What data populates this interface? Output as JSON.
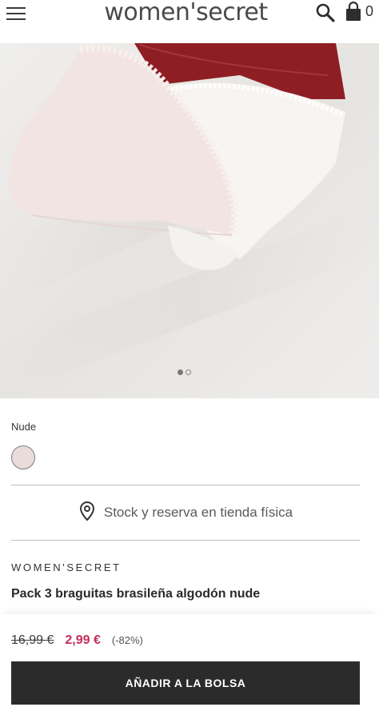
{
  "header": {
    "logo": "women'secret",
    "bag_count": "0"
  },
  "gallery": {
    "slide_count": 2,
    "active_slide": 1
  },
  "product": {
    "color_label": "Nude",
    "swatch_color": "#e9dcdb",
    "stock_label": "Stock y reserva en tienda física",
    "brand": "WOMEN'SECRET",
    "name": "Pack 3 braguitas brasileña algodón nude"
  },
  "price": {
    "old": "16,99 €",
    "new": "2,99 €",
    "discount": "(-82%)",
    "sale_color": "#c0305a"
  },
  "cta": {
    "add_to_bag": "AÑADIR A LA BOLSA"
  },
  "icons": [
    "menu-icon",
    "search-icon",
    "shopping-bag-icon",
    "location-pin-icon"
  ]
}
